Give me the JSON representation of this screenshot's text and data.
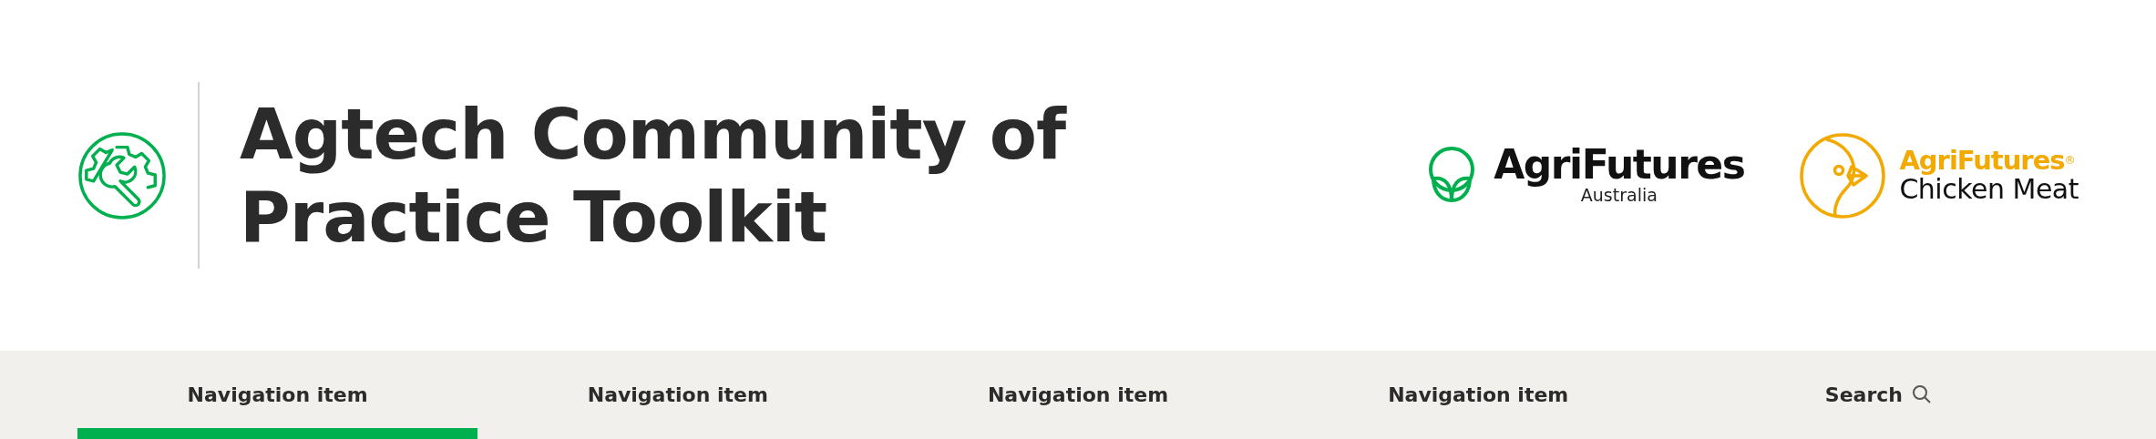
{
  "header": {
    "title_lines": [
      "Agtech Community of",
      "Practice Toolkit"
    ],
    "logos": [
      {
        "kind": "agrifutures",
        "name": "AgriFutures",
        "subtitle": "Australia"
      },
      {
        "kind": "chicken",
        "name": "AgriFutures$^{®}$",
        "subtitle": "Chicken Meat"
      }
    ]
  },
  "nav": [
    {
      "label": "Navigation item",
      "kind": "link",
      "selected": true
    },
    {
      "label": "Navigation item",
      "kind": "link",
      "selected": false
    },
    {
      "label": "Navigation item",
      "kind": "link",
      "selected": false
    },
    {
      "label": "Navigation item",
      "kind": "link",
      "selected": false
    },
    {
      "label": "Search",
      "kind": "search",
      "selected": false
    }
  ]
}
